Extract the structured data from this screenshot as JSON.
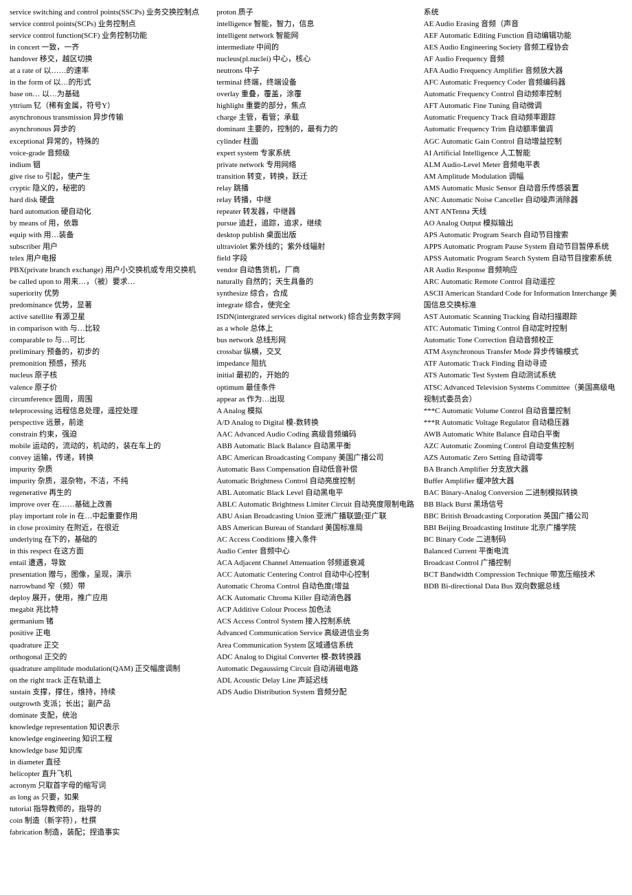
{
  "columns": [
    {
      "id": "col1",
      "entries": [
        "service switching and control points(SSCPs)  业务交换控制点",
        "service control points(SCPs)      业务控制点",
        "service control function(SCF)     业务控制功能",
        "in concert    一致，一齐",
        "handover     移交，越区切换",
        "at a rate of  以……的速率",
        "in the form of  以…的形式",
        "base on…    以…为基础",
        "yttrium     钇（稀有金属，符号Y）",
        "asynchronous transmission     异步传输",
        "asynchronous     异步的",
        "exceptional  异常的，特殊的",
        "voice-grade  音频级",
        "indium      铟",
        "give rise to  引起，使产生",
        "cryptic      隐义的，秘密的",
        "hard disk    硬盘",
        "hard automation  硬自动化",
        "by means of  用，依靠",
        "equip with   用…装备",
        "subscriber   用户",
        "telex  用户电报",
        "PBX(private branch exchange)   用户小交换机或专用交换机",
        "be called upon to  用来…，（被）要求…",
        "superiority  优势",
        "predominance     优势，显著",
        "active satellite    有源卫星",
        "in comparison with  与…比较",
        "comparable to       与…可比",
        "preliminary   预备的，初步的",
        "premonition  预感，预兆",
        "nucleus      原子核",
        "valence      原子价",
        "circumference     圆周，周围",
        "teleprocessing     远程信息处理，遥控处理",
        "perspective  远景，前途",
        "constrain    约束，强迫",
        "mobile      运动的，流动的，机动的，装在车上的",
        "convey      运输，传递，转换",
        "impurity     杂质",
        "impurity     杂质，混杂物，不洁，不纯",
        "regenerative  再生的",
        "improve over    在……基础上改善",
        "play important role in   在…中起重要作用",
        "in close proximity  在附近，在很近",
        "underlying   在下的，基础的",
        "in this respect   在这方面",
        "entail  遭遇，导致",
        "presentation  赠与，图像，呈现，演示",
        "narrowband  窄（频）带",
        "deploy      展开，使用，推广应用",
        "megabit     兆比特",
        "germanium   锗",
        "positive    正电",
        "quadrature   正交",
        "orthogonal   正交的",
        "quadrature amplitude modulation(QAM)      正交幅度调制",
        "on the right track  正在轨道上",
        "sustain      支撑，撑住，维持，持续",
        "outgrowth    支派；长出；副产品",
        "dominate     支配，统治",
        "knowledge representation      知识表示",
        "knowledge engineering   知识工程",
        "knowledge base    知识库",
        "in diameter   直径",
        "helicopter    直升飞机",
        "acronym      只取首字母的缩写词",
        "as long as    只要，如果",
        "tutorial      指导教师的，指导的",
        "coin  制造（新字符），杜撰",
        "fabrication   制造，装配；捏造事实"
      ]
    },
    {
      "id": "col2",
      "entries": [
        "proton       质子",
        "intelligence   智能，智力，信息",
        "intelligent network  智能网",
        "intermediate  中间的",
        "nucleus(pl.nuclei)  中心，核心",
        "neutrons     中子",
        "terminal     终端，终端设备",
        "overlay      重叠，覆盖，涂覆",
        "highlight    重要的部分，焦点",
        "charge       主管，看管；承载",
        "dominant     主要的，控制的，最有力的",
        "cylinder     柱面",
        "expert system     专家系统",
        "private network    专用网络",
        "transition    转变，转换，跃迁",
        "relay  跳播",
        "relay  转播，中继",
        "repeater     转发器，中继器",
        "pursue       追赶，追踪，追求，继续",
        "desktop publish     桌面出版",
        "ultraviolet   紫外线的；紫外线辐射",
        "field   字段",
        "vendor      自动售货机，厂商",
        "naturally     自然的；天生具备的",
        "synthesize    综合，合成",
        "integrate     综合，使完全",
        "ISDN(intergrated services digital network)    综合业务数字网",
        "as a whole    总体上",
        "bus network  总线形网",
        "crossbar     纵横，交叉",
        "impedance    阻抗",
        "initial  最初的，开始的",
        "optimum     最佳条件",
        "appear as    作为…出现",
        "  A Analog    模拟",
        "  A/D Analog to Digital  模-数转换",
        "  AAC Advanced Audio Coding  高级音频编码",
        "  ABB Automatic Black Balance  自动黑平衡",
        "  ABC American Broadcasting Company  美国广播公司",
        "  Automatic Bass Compensation  自动低音补偿",
        "  Automatic Brightness Control  自动亮度控制",
        "  ABL Automatic Black Level  自动黑电平",
        "  ABLC Automatic Brightness Limiter Circuit  自动亮度限制电路",
        "  ABU Asian Broadcasting Union  亚洲广播联盟(亚广联",
        "  ABS American Bureau of Standard  美国标准局",
        "  AC Access Conditions  接入条件",
        "  Audio Center  音频中心",
        "  ACA Adjacent Channel Attenuation  邻频道衰减",
        "  ACC Automatic Centering Control  自动中心控制",
        "  Automatic Chroma Control  自动色度(增益",
        "  ACK Automatic Chroma Killer  自动消色器",
        "  ACP Additive Colour Process  加色法",
        "  ACS Access Control System  接入控制系统",
        "  Advanced Communication Service  高级进信业务",
        "  Area Communication System  区域通信系统",
        "  ADC Analog to Digital Converter  模-数转换器",
        "  Automatic Degaussirng Circuit  自动消磁电路",
        "  ADL Acoustic Delay Line  声延迟线",
        "  ADS Audio Distribution System  音频分配"
      ]
    },
    {
      "id": "col3",
      "entries": [
        "系统",
        "  AE Audio Erasing  音频（声音",
        "  AEF Automatic Editing Function  自动编辑功能",
        "  AES Audio Engineering Society  音频工程协会",
        "  AF Audio Frequency  音频",
        "  AFA Audio Frequency Amplifier  音频放大器",
        "  AFC Automatic Frequency Coder  音频编码器",
        "  Automatic Frequency Control  自动频率控制",
        "  AFT Automatic Fine Tuning  自动微调",
        "  Automatic Frequency Track  自动频率跟踪",
        "  Automatic Frequency Trim  自动额率偏调",
        "  AGC Automatic Gain Control  自动增益控制",
        "  AI Artificial Intelligence  人工智能",
        "  ALM Audio-Level Meter  音频电平表",
        "  AM Amplitude Modulation  调幅",
        "  AMS Automatic Music Sensor  自动音乐传感装置",
        "  ANC Automatic Noise Canceller  自动噪声消除器",
        "  ANT ANTenna  天线",
        "  AO Analog Output  模拟输出",
        "  APS Automatic Program Search  自动节目搜索",
        "  APPS Automatic Program Pause System  自动节目暂停系统",
        "  APSS Automatic Program Search System  自动节目搜索系统",
        "  AR Audio Response  音频响应",
        "  ARC Automatic Remote Control  自动遥控",
        "  ASCII American Standard Code for Information Interchange   美国信息交换标准",
        "  AST Automatic Scanning Tracking  自动扫描跟踪",
        "  ATC Automatic Timing Control  自动定时控制",
        "  Automatic Tone Correction  自动音频校正",
        "  ATM Asynchronous Transfer Mode  异步传输模式",
        "  ATF Automatic Track Finding  自动寻迹",
        "  ATS Automatic Test System  自动测试系统",
        "  ATSC Advanced Television Systems Committee（美国高级电视制式委员会）",
        "  ***C Automatic Volume Control  自动音量控制",
        "  ***R Automatic Voltage Regulator  自动稳压器",
        "  AWB Automatic White Balance  自动白平衡",
        "  AZC Automatic Zooming Control  自动变焦控制",
        "  AZS    Automatic Zero Setting  自动调零",
        "  BA Branch Amplifier  分支放大器",
        "  Buffer Amplifier  缓冲放大器",
        "  BAC Binary-Analog Conversion  二进制模拟转换",
        "  BB Black Burst  黑场信号",
        "  BBC British Broadcasting Corporation  英国广播公司",
        "  BBI Beijing Broadcasting Institute  北京广播学院",
        "  BC Binary Code  二进制码",
        "  Balanced Current  平衡电流",
        "  Broadcast Control  广播控制",
        "  BCT Bandwidth Compression Technique  带宽压缩技术",
        "  BDB Bi-directional Data Bus  双向数据总线"
      ]
    }
  ]
}
